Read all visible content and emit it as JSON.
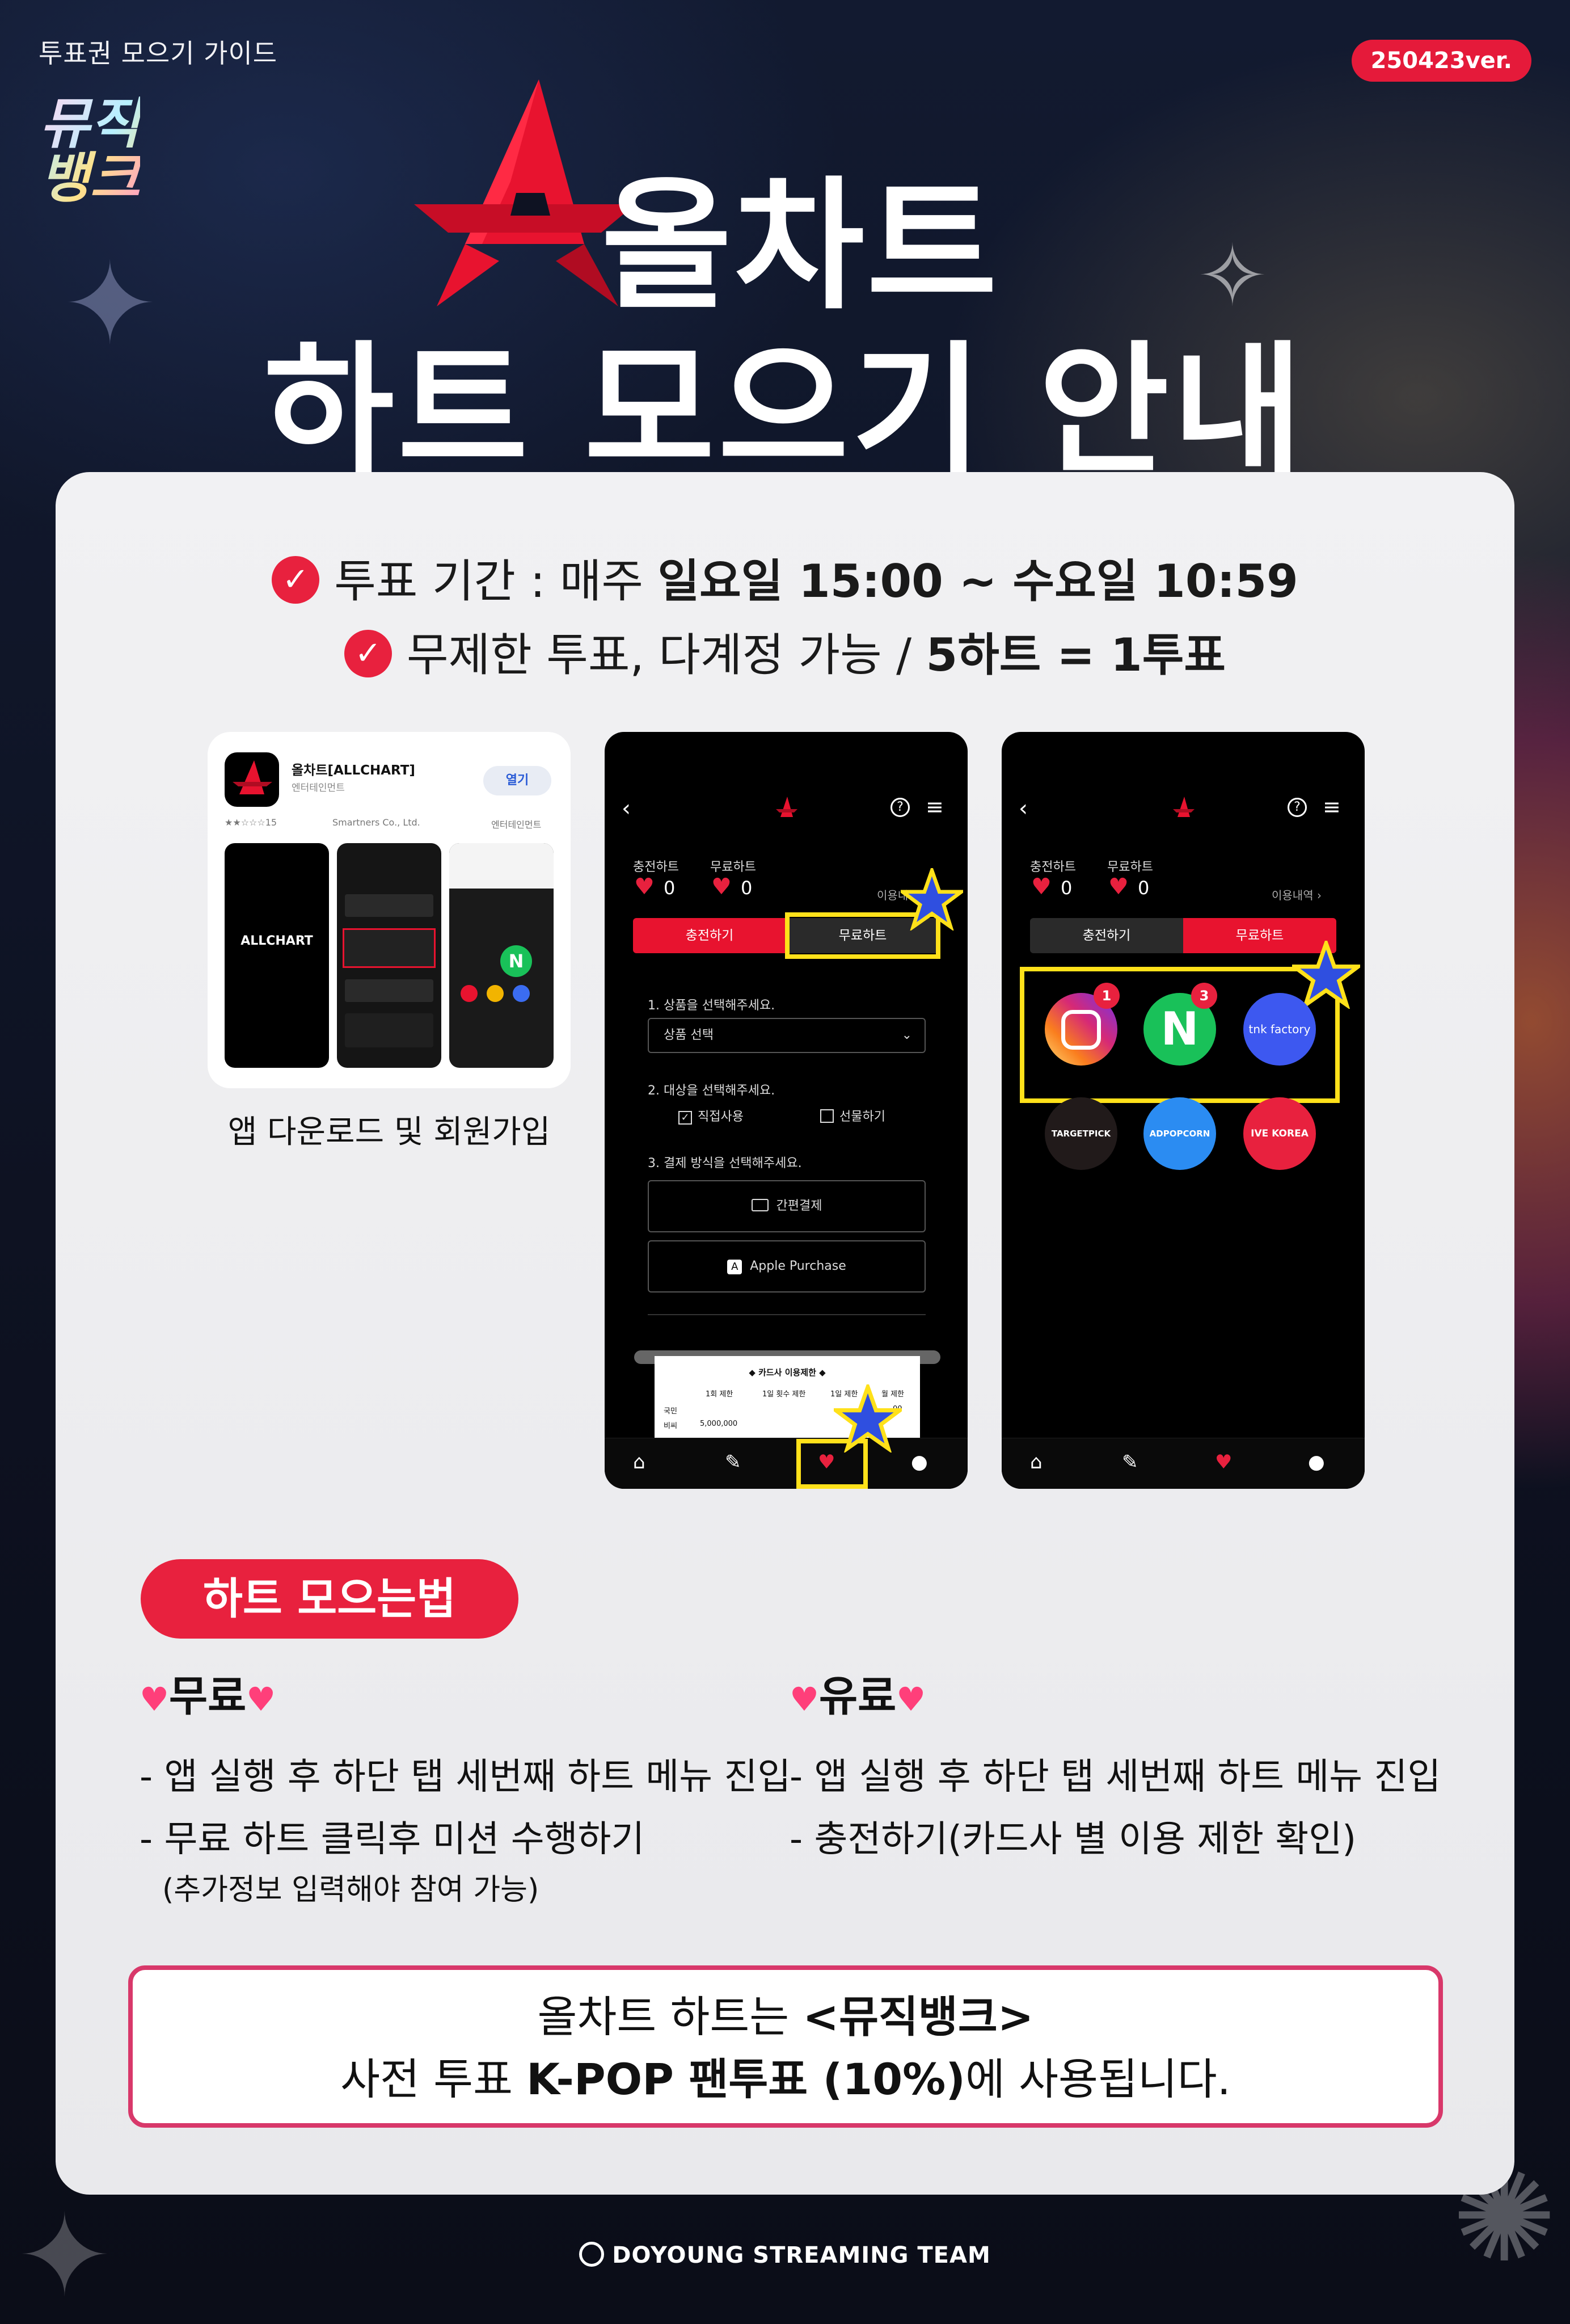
{
  "header": {
    "guide_tag": "투표권 모으기 가이드",
    "version_badge": "250423ver.",
    "show_logo": "뮤직뱅크",
    "title_line1": "올차트",
    "title_line2": "하트 모으기 안내"
  },
  "info": {
    "line1_prefix": "투표 기간 : 매주 ",
    "line1_bold": "일요일 15:00 ~ 수요일 10:59",
    "line2_prefix": "무제한 투표, 다계정 가능 / ",
    "line2_bold": "5하트 = 1투표"
  },
  "store": {
    "app_name": "올차트[ALLCHART]",
    "app_category": "엔터테인먼트",
    "open_label": "열기",
    "rating": "★★☆☆☆15",
    "developer": "Smartners Co., Ltd.",
    "genre": "엔터테인먼트",
    "splash_text": "ALLCHART",
    "caption": "앱 다운로드 및 회원가입"
  },
  "phone_paid": {
    "charged_label": "충전하트",
    "free_label": "무료하트",
    "charged_count": "0",
    "free_count": "0",
    "history_label": "이용내",
    "tab_charge": "충전하기",
    "tab_free": "무료하트",
    "step1": "1. 상품을 선택해주세요.",
    "select_placeholder": "상품 선택",
    "step2": "2. 대상을 선택해주세요.",
    "opt_self": "직접사용",
    "opt_gift": "선물하기",
    "step3": "3. 결제 방식을 선택해주세요.",
    "pay_simple": "간편결제",
    "pay_apple": "Apple Purchase",
    "receipt_title": "◆ 카드사 이용제한 ◆",
    "receipt_cols": [
      "1회 제한",
      "1일 횟수 제한",
      "1일 제한",
      "월 제한"
    ],
    "receipt_rows": [
      {
        "name": "국민",
        "a": "-",
        "b": "-",
        "c": "",
        "d": "00"
      },
      {
        "name": "비씨",
        "a": "5,000,000",
        "b": "-",
        "c": "",
        "d": ""
      }
    ]
  },
  "phone_free": {
    "charged_label": "충전하트",
    "free_label": "무료하트",
    "charged_count": "0",
    "free_count": "0",
    "history_label": "이용내역 ›",
    "tab_charge": "충전하기",
    "tab_free": "무료하트",
    "offerwalls": [
      {
        "name": "instagram",
        "label": "",
        "badge": "1"
      },
      {
        "name": "naver",
        "label": "N",
        "badge": "3"
      },
      {
        "name": "tnk",
        "label": "tnk factory",
        "badge": ""
      },
      {
        "name": "targetpick",
        "label": "TARGETPICK",
        "badge": ""
      },
      {
        "name": "adpopcorn",
        "label": "ADPOPCORN",
        "badge": ""
      },
      {
        "name": "ivekorea",
        "label": "IVE KOREA",
        "badge": ""
      }
    ]
  },
  "howto": {
    "pill": "하트 모으는법",
    "free_title": "무료",
    "paid_title": "유료",
    "free_line1": "- 앱 실행 후 하단 탭 세번째 하트 메뉴 진입",
    "free_line2": "- 무료 하트 클릭후 미션 수행하기",
    "free_note": "(추가정보 입력해야 참여 가능)",
    "paid_line1": "- 앱 실행 후 하단 탭 세번째 하트 메뉴 진입",
    "paid_line2": "- 충전하기(카드사 별 이용 제한 확인)"
  },
  "notice": {
    "line1_prefix": "올차트 하트는 ",
    "line1_bold": "<뮤직뱅크>",
    "line2_prefix": "사전 투표 ",
    "line2_bold": "K-POP 팬투표 (10%)",
    "line2_suffix": "에 사용됩니다."
  },
  "credit": "DOYOUNG STREAMING TEAM",
  "colors": {
    "accent_red": "#e8213e",
    "highlight_yellow": "#ffe11a",
    "star_blue": "#2f4fe0",
    "notice_border": "#d8386a"
  },
  "icons": [
    "chevron-left-icon",
    "allchart-logo-icon",
    "help-icon",
    "menu-icon",
    "home-icon",
    "vote-icon",
    "heart-icon",
    "user-icon",
    "card-icon",
    "appstore-icon",
    "check-icon",
    "star-icon"
  ]
}
